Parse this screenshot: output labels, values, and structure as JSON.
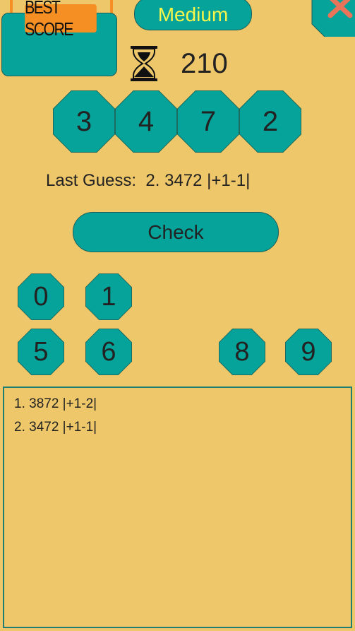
{
  "header": {
    "best_score_label": "BEST SCORE",
    "difficulty": "Medium",
    "timer_value": "210"
  },
  "guess_slots": [
    "3",
    "4",
    "7",
    "2"
  ],
  "last_guess": {
    "label": "Last Guess:",
    "value": "2. 3472 |+1-1|"
  },
  "check_label": "Check",
  "keypad": [
    "0",
    "1",
    "5",
    "6",
    "8",
    "9"
  ],
  "history": [
    "1. 3872 |+1-2|",
    "2. 3472 |+1-1|"
  ],
  "colors": {
    "background": "#EDC76A",
    "teal": "#05A39A",
    "orange": "#F58F24",
    "difficulty_text": "#F6F64A",
    "close": "#E8745A"
  }
}
